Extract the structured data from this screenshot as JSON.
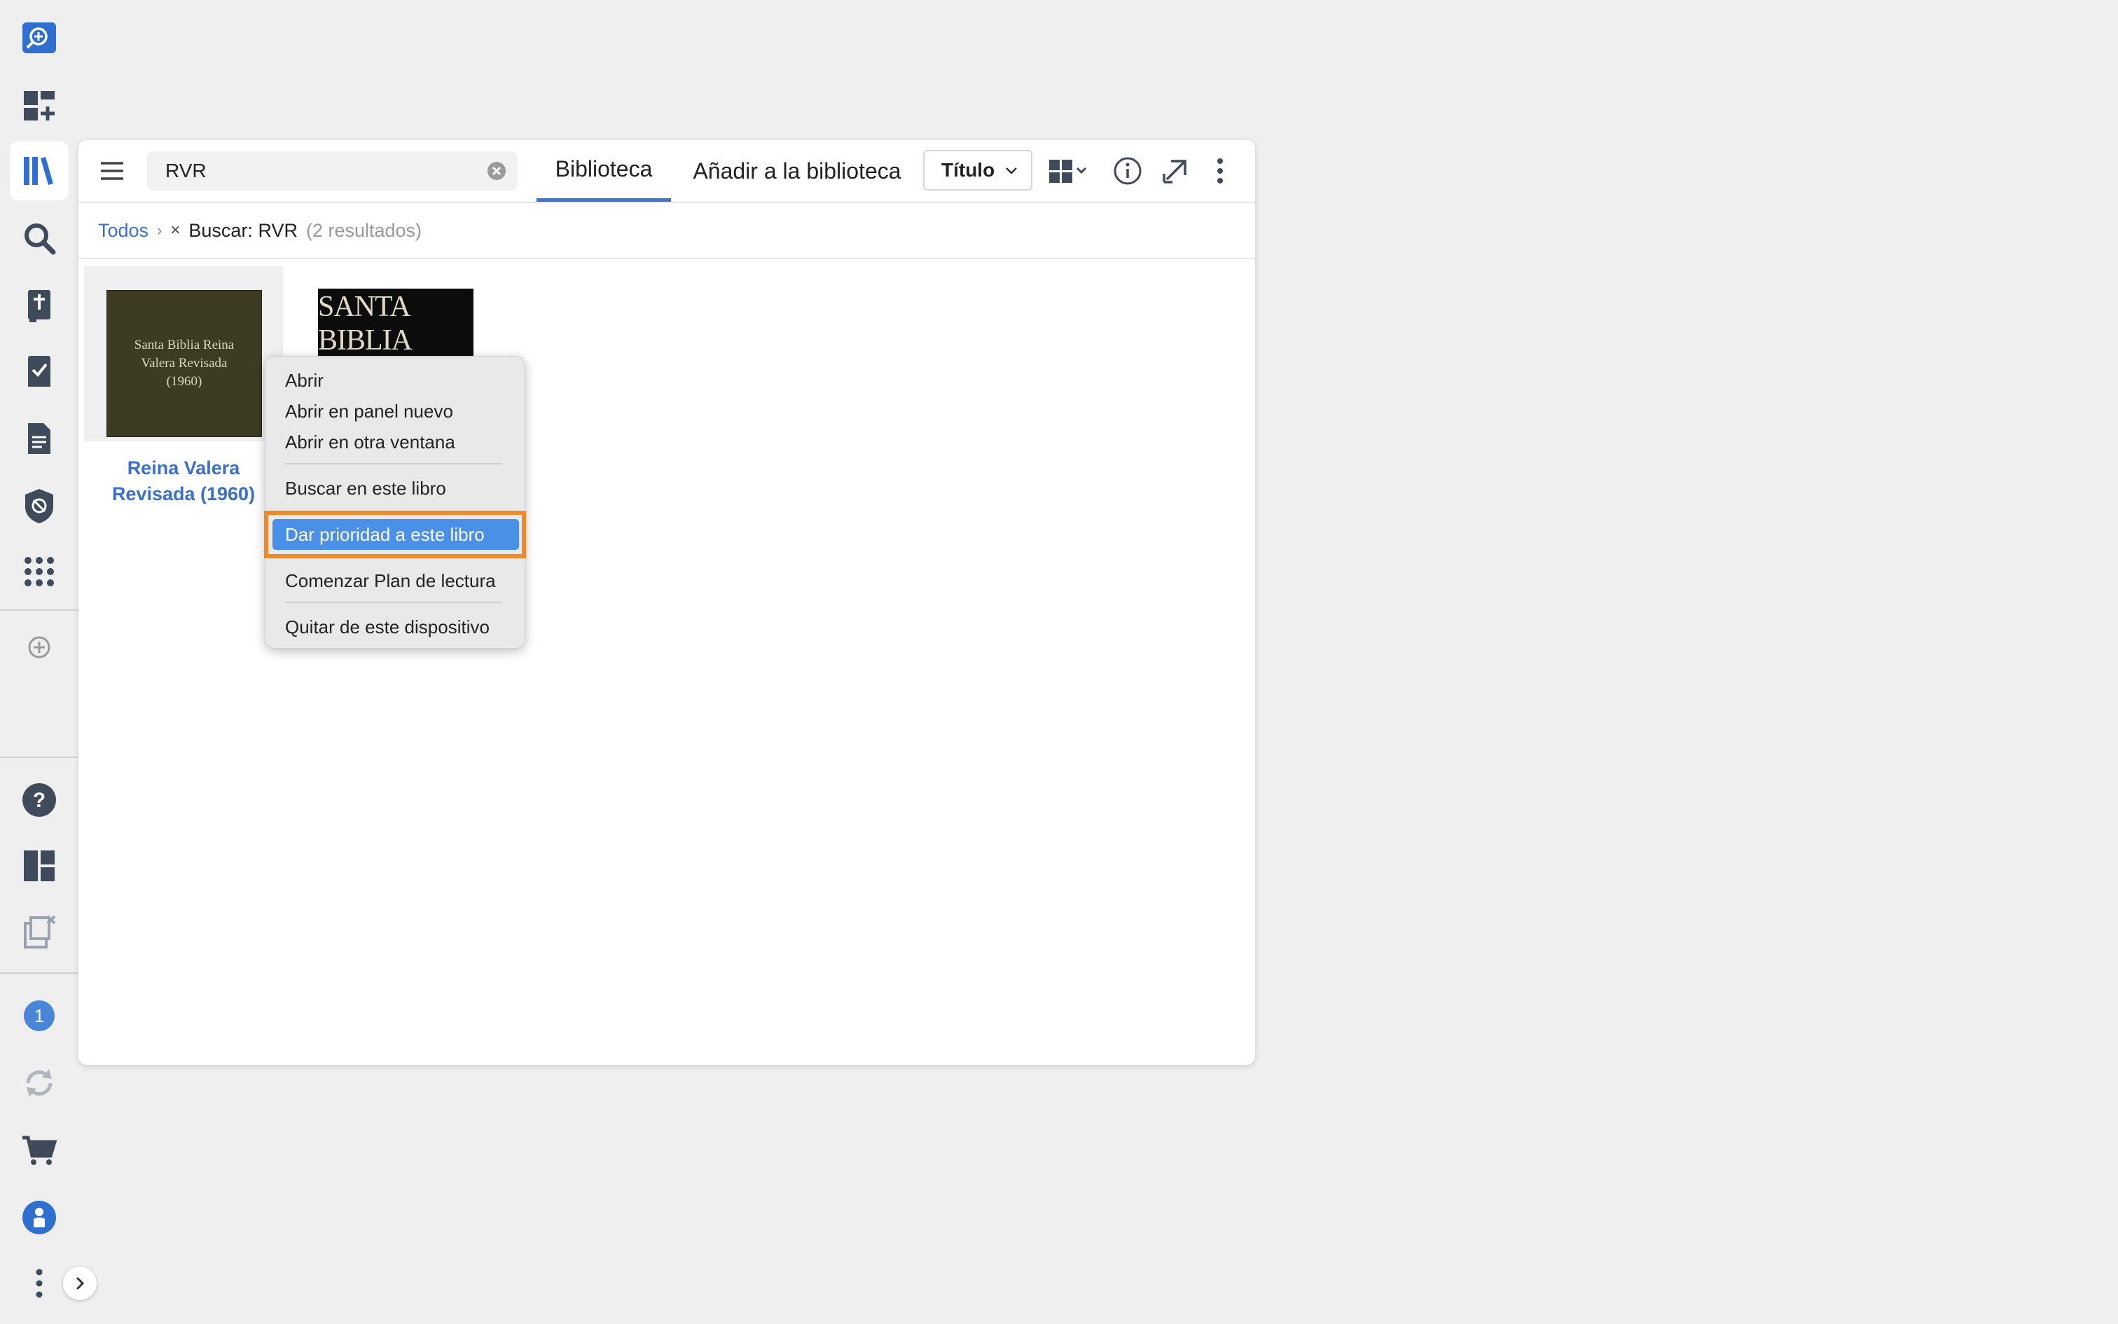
{
  "rail": {
    "badge_count": "1"
  },
  "toolbar": {
    "search_value": "RVR",
    "tabs": [
      "Biblioteca",
      "Añadir a la biblioteca"
    ],
    "sort_label": "Título"
  },
  "breadcrumb": {
    "root": "Todos",
    "current": "Buscar: RVR",
    "count": "(2 resultados)"
  },
  "books": [
    {
      "cover_text": "Santa Biblia Reina\nValera Revisada\n(1960)",
      "title": "Reina Valera Revisada (1960)"
    },
    {
      "cover_text": "SANTA BIBLIA"
    }
  ],
  "context_menu": {
    "items": [
      "Abrir",
      "Abrir en panel nuevo",
      "Abrir en otra ventana",
      "Buscar en este libro",
      "Dar prioridad a este libro",
      "Comenzar Plan de lectura",
      "Quitar de este dispositivo"
    ]
  },
  "colors": {
    "accent": "#3c6fc7",
    "highlight": "#4a8fe8",
    "annotation": "#ef8a2c",
    "rail_icon": "#3f4a5a"
  }
}
